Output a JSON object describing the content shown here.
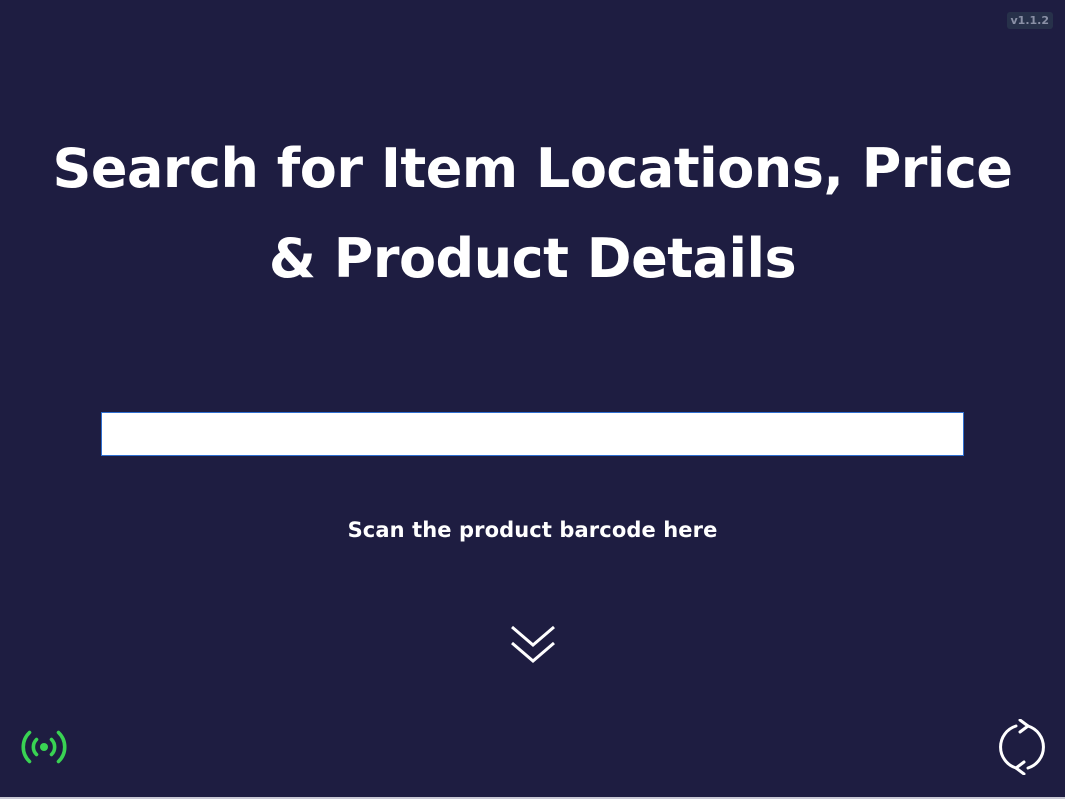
{
  "app": {
    "version": "v1.1.2"
  },
  "header": {
    "title_line1": "Search for Item Locations, Price",
    "title_line2": "& Product Details"
  },
  "search": {
    "value": "",
    "placeholder": ""
  },
  "hint": {
    "text": "Scan the product barcode here"
  },
  "icons": {
    "scroll_indicator": "double-chevron-down-icon",
    "connection_status": "signal-broadcast-icon",
    "refresh": "refresh-icon"
  },
  "colors": {
    "background": "#1e1d41",
    "accent_green": "#39d353",
    "text": "#ffffff",
    "input_border": "#2f6fd0"
  }
}
